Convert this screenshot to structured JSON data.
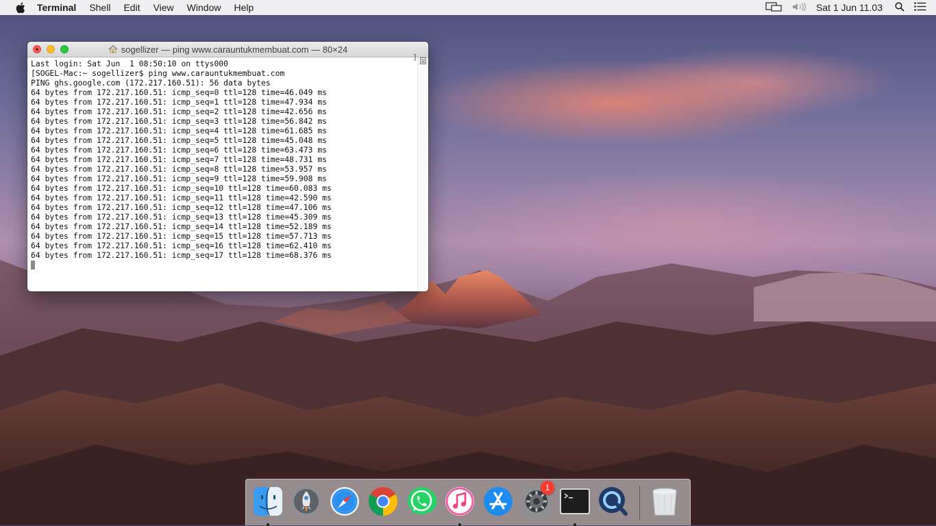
{
  "menubar": {
    "app_name": "Terminal",
    "menus": [
      "Shell",
      "Edit",
      "View",
      "Window",
      "Help"
    ],
    "clock": "Sat 1 Jun  11.03"
  },
  "terminal": {
    "title": "sogellizer — ping www.carauntukmembuat.com — 80×24",
    "lines": [
      "Last login: Sat Jun  1 08:50:10 on ttys000",
      "[SOGEL-Mac:~ sogellizer$ ping www.carauntukmembuat.com",
      "PING ghs.google.com (172.217.160.51): 56 data bytes",
      "64 bytes from 172.217.160.51: icmp_seq=0 ttl=128 time=46.049 ms",
      "64 bytes from 172.217.160.51: icmp_seq=1 ttl=128 time=47.934 ms",
      "64 bytes from 172.217.160.51: icmp_seq=2 ttl=128 time=42.656 ms",
      "64 bytes from 172.217.160.51: icmp_seq=3 ttl=128 time=56.842 ms",
      "64 bytes from 172.217.160.51: icmp_seq=4 ttl=128 time=61.685 ms",
      "64 bytes from 172.217.160.51: icmp_seq=5 ttl=128 time=45.048 ms",
      "64 bytes from 172.217.160.51: icmp_seq=6 ttl=128 time=63.473 ms",
      "64 bytes from 172.217.160.51: icmp_seq=7 ttl=128 time=48.731 ms",
      "64 bytes from 172.217.160.51: icmp_seq=8 ttl=128 time=53.957 ms",
      "64 bytes from 172.217.160.51: icmp_seq=9 ttl=128 time=59.908 ms",
      "64 bytes from 172.217.160.51: icmp_seq=10 ttl=128 time=60.083 ms",
      "64 bytes from 172.217.160.51: icmp_seq=11 ttl=128 time=42.590 ms",
      "64 bytes from 172.217.160.51: icmp_seq=12 ttl=128 time=47.106 ms",
      "64 bytes from 172.217.160.51: icmp_seq=13 ttl=128 time=45.309 ms",
      "64 bytes from 172.217.160.51: icmp_seq=14 ttl=128 time=52.189 ms",
      "64 bytes from 172.217.160.51: icmp_seq=15 ttl=128 time=57.713 ms",
      "64 bytes from 172.217.160.51: icmp_seq=16 ttl=128 time=62.410 ms",
      "64 bytes from 172.217.160.51: icmp_seq=17 ttl=128 time=68.376 ms"
    ],
    "scroll_mark": "]"
  },
  "dock": {
    "items": [
      {
        "icon": "finder-icon",
        "running": true
      },
      {
        "icon": "launchpad-icon",
        "running": false
      },
      {
        "icon": "safari-icon",
        "running": false
      },
      {
        "icon": "chrome-icon",
        "running": false
      },
      {
        "icon": "whatsapp-icon",
        "running": false
      },
      {
        "icon": "itunes-icon",
        "running": true
      },
      {
        "icon": "app-store-icon",
        "running": false
      },
      {
        "icon": "system-preferences-icon",
        "running": false,
        "badge": "1"
      },
      {
        "icon": "terminal-icon",
        "running": true
      },
      {
        "icon": "quicktime-icon",
        "running": false
      },
      {
        "icon": "trash-icon",
        "running": false
      }
    ]
  }
}
